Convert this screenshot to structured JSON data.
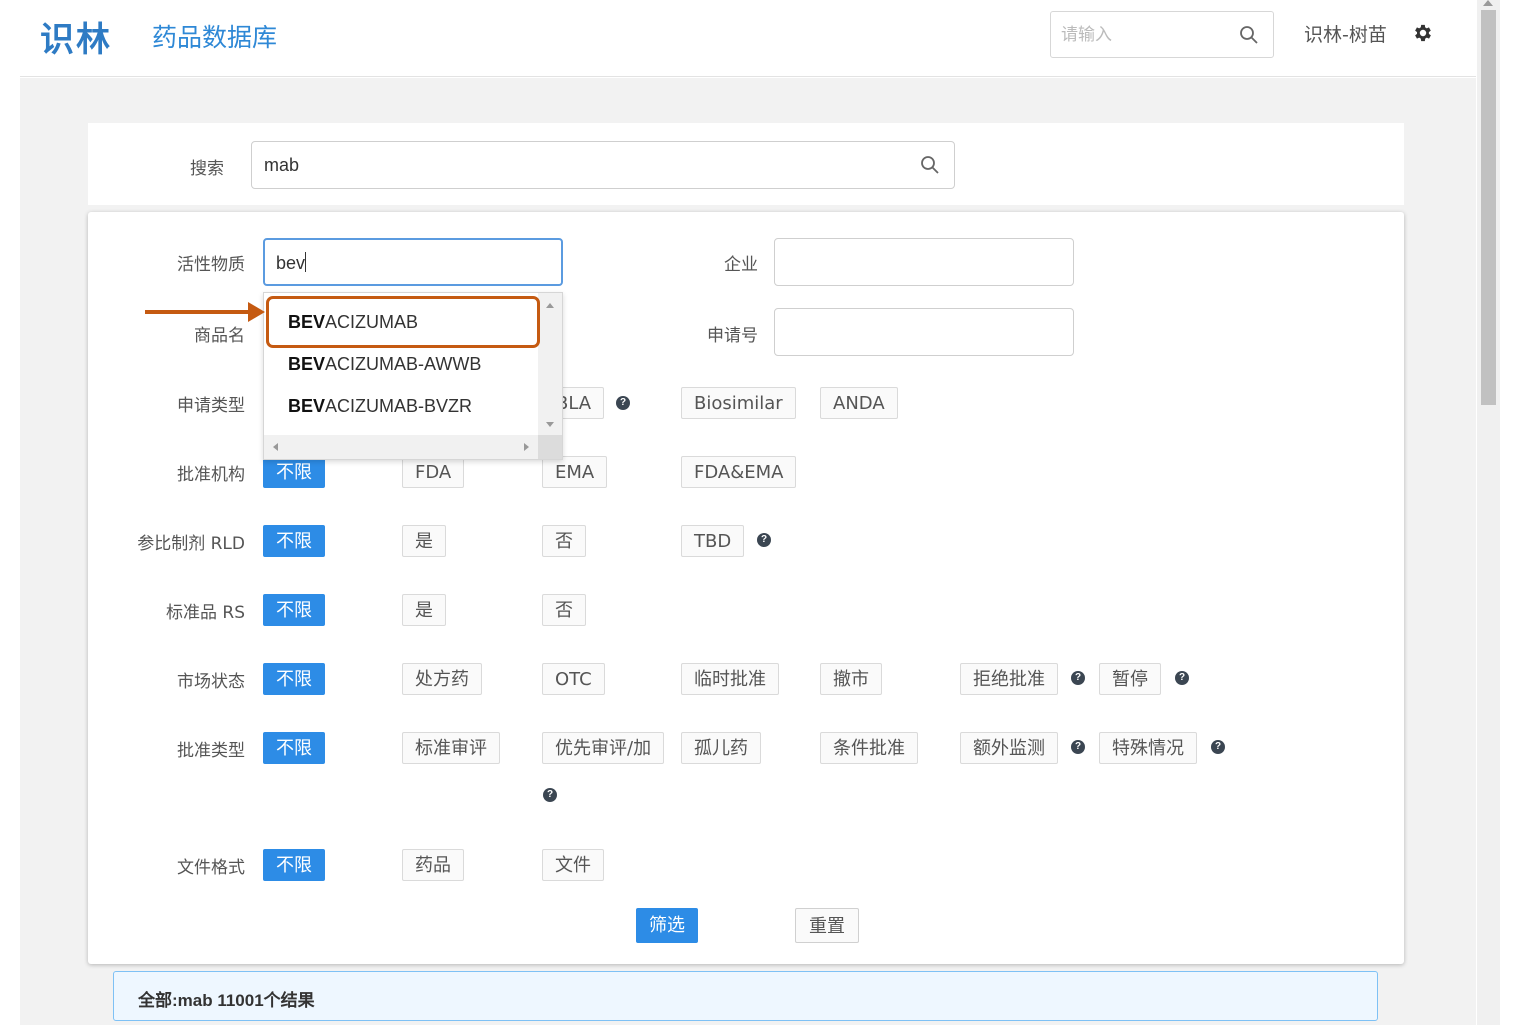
{
  "header": {
    "brand": "识林",
    "title": "药品数据库",
    "search_placeholder": "请输入",
    "user": "识林-树苗"
  },
  "search": {
    "label": "搜索",
    "value": "mab"
  },
  "filters": {
    "active_substance": {
      "label": "活性物质",
      "value": "bev"
    },
    "company": {
      "label": "企业",
      "value": ""
    },
    "trade_name": {
      "label": "商品名"
    },
    "application_no": {
      "label": "申请号",
      "value": ""
    },
    "application_type": {
      "label": "申请类型",
      "options": [
        "BLA",
        "Biosimilar",
        "ANDA"
      ]
    },
    "approval_agency": {
      "label": "批准机构",
      "options": [
        "不限",
        "FDA",
        "EMA",
        "FDA&EMA"
      ]
    },
    "rld": {
      "label": "参比制剂 RLD",
      "options": [
        "不限",
        "是",
        "否",
        "TBD"
      ]
    },
    "rs": {
      "label": "标准品 RS",
      "options": [
        "不限",
        "是",
        "否"
      ]
    },
    "market_status": {
      "label": "市场状态",
      "options": [
        "不限",
        "处方药",
        "OTC",
        "临时批准",
        "撤市",
        "拒绝批准",
        "暂停"
      ]
    },
    "approval_type": {
      "label": "批准类型",
      "options": [
        "不限",
        "标准审评",
        "优先审评/加",
        "孤儿药",
        "条件批准",
        "额外监测",
        "特殊情况"
      ]
    },
    "file_format": {
      "label": "文件格式",
      "options": [
        "不限",
        "药品",
        "文件"
      ]
    }
  },
  "buttons": {
    "filter": "筛选",
    "reset": "重置"
  },
  "autocomplete": {
    "items": [
      {
        "match": "BEV",
        "rest": "ACIZUMAB"
      },
      {
        "match": "BEV",
        "rest": "ACIZUMAB-AWWB"
      },
      {
        "match": "BEV",
        "rest": "ACIZUMAB-BVZR"
      }
    ],
    "highlighted_index": 0
  },
  "result": {
    "text": "全部:mab  11001个结果"
  },
  "colors": {
    "primary": "#2d8ce6",
    "brand": "#2e7bc4",
    "annotation": "#c55a11"
  }
}
